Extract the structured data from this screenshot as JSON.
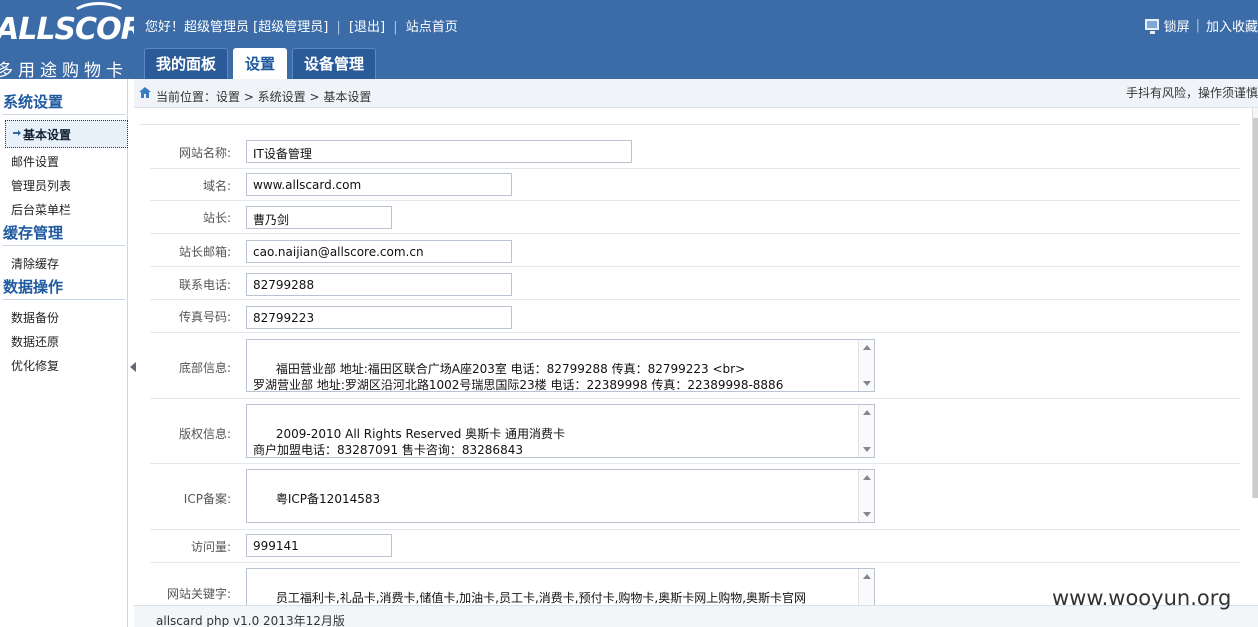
{
  "logo": {
    "text": "ALLSCORE",
    "subtitle": "多用途购物卡"
  },
  "topbar": {
    "greeting": "您好！超级管理员 [超级管理员]",
    "logout": "[退出]",
    "site_home": "站点首页",
    "lock_screen": "锁屏",
    "add_favorite": "加入收藏"
  },
  "tabs": [
    {
      "label": "我的面板"
    },
    {
      "label": "设置"
    },
    {
      "label": "设备管理"
    }
  ],
  "sidebar": {
    "groups": [
      {
        "title": "系统设置",
        "items": [
          "基本设置",
          "邮件设置",
          "管理员列表",
          "后台菜单栏"
        ]
      },
      {
        "title": "缓存管理",
        "items": [
          "清除缓存"
        ]
      },
      {
        "title": "数据操作",
        "items": [
          "数据备份",
          "数据还原",
          "优化修复"
        ]
      }
    ]
  },
  "breadcrumb": "当前位置：设置 > 系统设置 > 基本设置",
  "warning": "手抖有风险，操作须谨慎",
  "form": {
    "site_name": {
      "label": "网站名称:",
      "value": "IT设备管理"
    },
    "domain": {
      "label": "域名:",
      "value": "www.allscard.com"
    },
    "owner": {
      "label": "站长:",
      "value": "曹乃剑"
    },
    "email": {
      "label": "站长邮箱:",
      "value": "cao.naijian@allscore.com.cn"
    },
    "phone": {
      "label": "联系电话:",
      "value": "82799288"
    },
    "fax": {
      "label": "传真号码:",
      "value": "82799223"
    },
    "footer_info": {
      "label": "底部信息:",
      "value": "福田营业部 地址:福田区联合广场A座203室 电话：82799288 传真：82799223 <br>\n罗湖营业部 地址:罗湖区沿河北路1002号瑞思国际23楼 电话：22389998 传真：22389998-8886"
    },
    "copyright": {
      "label": "版权信息:",
      "value": "2009-2010 All Rights Reserved 奥斯卡 通用消费卡\n商户加盟电话：83287091 售卡咨询：83286843"
    },
    "icp": {
      "label": "ICP备案:",
      "value": "粤ICP备12014583"
    },
    "visits": {
      "label": "访问量:",
      "value": "999141"
    },
    "keywords": {
      "label": "网站关键字:",
      "value": "员工福利卡,礼品卡,消费卡,储值卡,加油卡,员工卡,消费卡,预付卡,购物卡,奥斯卡网上购物,奥斯卡官网"
    }
  },
  "footer": "allscard php v1.0 2013年12月版",
  "watermark": "www.wooyun.org"
}
